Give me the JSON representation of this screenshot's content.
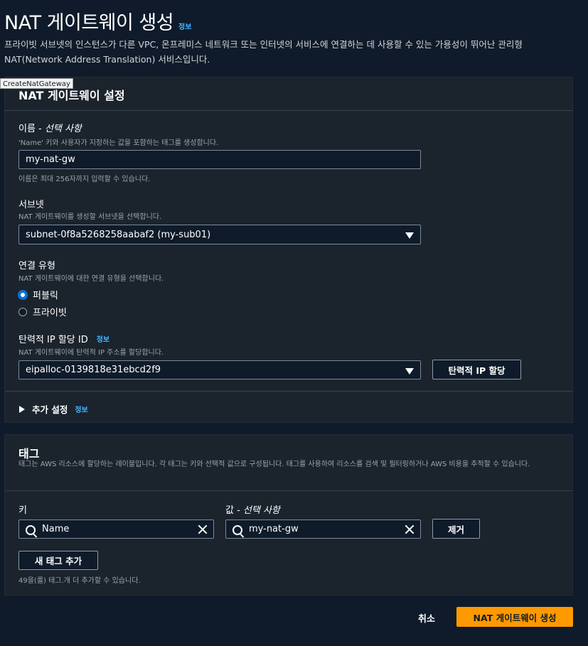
{
  "header": {
    "title": "NAT 게이트웨이 생성",
    "info_label": "정보",
    "description": "프라이빗 서브넷의 인스턴스가 다른 VPC, 온프레미스 네트워크 또는 인터넷의 서비스에 연결하는 데 사용할 수 있는 가용성이 뛰어난 관리형 NAT(Network Address Translation) 서비스입니다."
  },
  "tooltip": "CreateNatGateway",
  "settings": {
    "title": "NAT 게이트웨이 설정",
    "name": {
      "label": "이름 - ",
      "label_optional": "선택 사항",
      "hint": "'Name' 키와 사용자가 지정하는 값을 포함하는 태그를 생성합니다.",
      "value": "my-nat-gw",
      "constraint": "이름은 최대 256자까지 입력할 수 있습니다."
    },
    "subnet": {
      "label": "서브넷",
      "hint": "NAT 게이트웨이를 생성할 서브넷을 선택합니다.",
      "value": "subnet-0f8a5268258aabaf2 (my-sub01)"
    },
    "connectivity": {
      "label": "연결 유형",
      "hint": "NAT 게이트웨이에 대한 연결 유형을 선택합니다.",
      "options": [
        "퍼블릭",
        "프라이빗"
      ],
      "selected": "퍼블릭"
    },
    "eip": {
      "label": "탄력적 IP 할당 ID",
      "info_label": "정보",
      "hint": "NAT 게이트웨이에 탄력적 IP 주소를 할당합니다.",
      "value": "eipalloc-0139818e31ebcd2f9",
      "allocate_button": "탄력적 IP 할당"
    },
    "additional": {
      "label": "추가 설정",
      "info_label": "정보"
    }
  },
  "tags": {
    "title": "태그",
    "description": "태그는 AWS 리소스에 할당하는 레이블입니다. 각 태그는 키와 선택적 값으로 구성됩니다. 태그를 사용하여 리소스를 검색 및 필터링하거나 AWS 비용을 추적할 수 있습니다.",
    "key_label": "키",
    "value_label": "값 - ",
    "value_label_optional": "선택 사항",
    "rows": [
      {
        "key": "Name",
        "value": "my-nat-gw",
        "remove_label": "제거"
      }
    ],
    "add_button": "새 태그 추가",
    "remaining_hint": "49을(를) 태그.개 더 추가할 수 있습니다."
  },
  "footer": {
    "cancel_label": "취소",
    "submit_label": "NAT 게이트웨이 생성"
  },
  "colors": {
    "background": "#0f1b2a",
    "card": "#1b232d",
    "link": "#42b4ff",
    "primary": "#ff9900",
    "radio_selected": "#0972d3"
  }
}
